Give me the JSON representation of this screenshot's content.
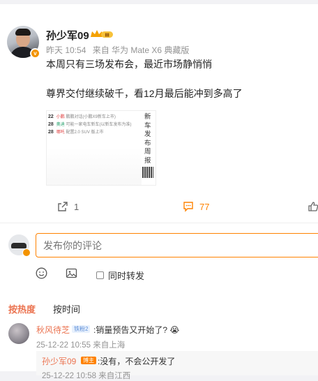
{
  "post": {
    "author": "孙少军09",
    "meta": {
      "time": "昨天 10:54",
      "source": "来自 华为 Mate X6 典藏版"
    },
    "lines": [
      "本周只有三场发布会，最近市场静悄悄",
      "尊界交付继续破千，看12月最后能冲到多高了"
    ],
    "poster": {
      "rows": [
        {
          "date": "22",
          "a": "小鹏",
          "b": "鹏鹏对话(小鹏X9新车上市)",
          "c": ""
        },
        {
          "date": "28",
          "a": "奥迪",
          "b": "可能一家电车新车(以新车发布为准)",
          "c": ""
        },
        {
          "date": "28",
          "a": "哪吒",
          "b": "配置2.0 SUV 版上市",
          "c": ""
        }
      ],
      "side_text": "新车发布周报"
    },
    "actions": {
      "repost_count": "1",
      "comment_count": "77"
    }
  },
  "compose": {
    "placeholder": "发布你的评论",
    "repost_label": "同时转发"
  },
  "sort_tabs": {
    "hot": "按热度",
    "time": "按时间"
  },
  "comments": [
    {
      "name": "秋风待芝",
      "tag": "铁粉2",
      "text": ":销量预告又开始了? 😭",
      "meta": "25-12-22 10:55 来自上海"
    }
  ],
  "replies": [
    {
      "name": "孙少军09",
      "tag": "博主",
      "text": ":没有，不会公开发了",
      "meta": "25-12-22 10:58 来自江西"
    }
  ],
  "colors": {
    "accent": "#ff8200",
    "link": "#eb7350",
    "muted": "#939393"
  }
}
